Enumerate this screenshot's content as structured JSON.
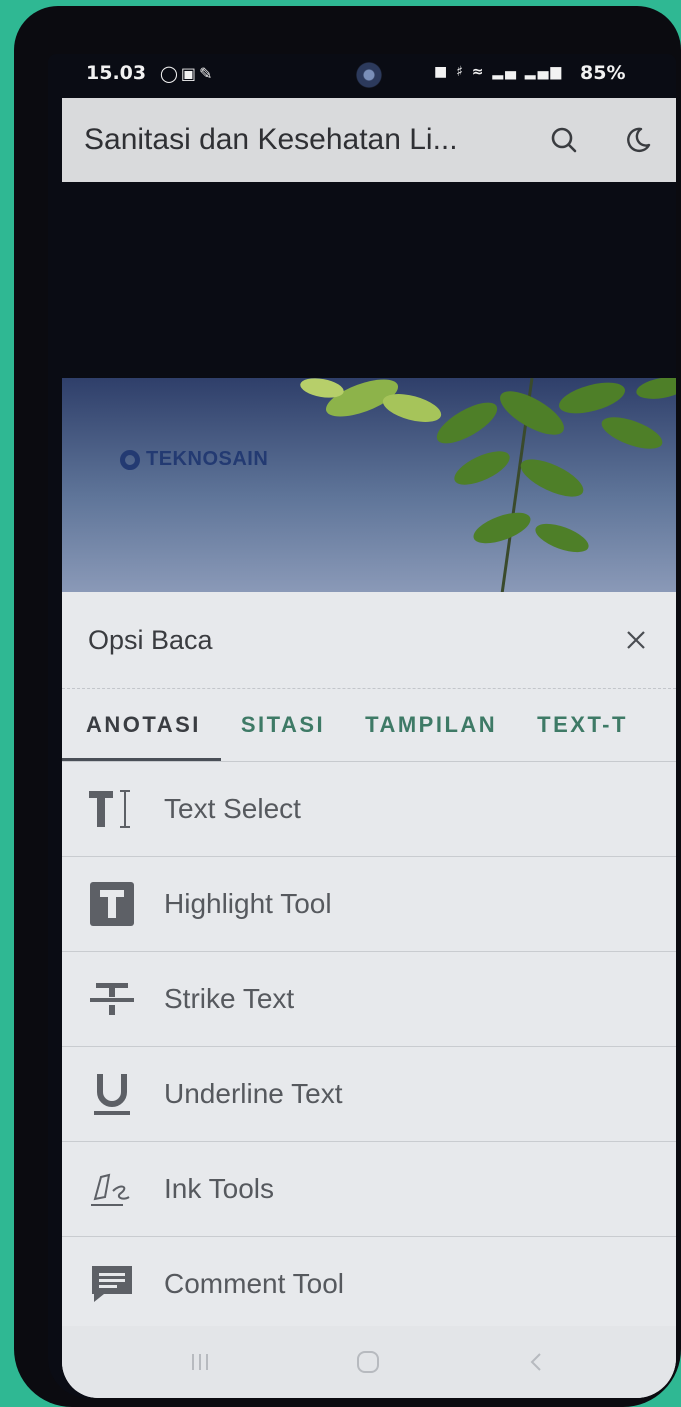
{
  "status_bar": {
    "time": "15.03",
    "left_icons": [
      "whatsapp-icon",
      "instagram-icon",
      "lock-icon"
    ],
    "right_icons": [
      "sim-icon",
      "mute-icon",
      "wifi-icon",
      "signal-icon",
      "lte-signal-icon"
    ],
    "battery": "85%"
  },
  "app_bar": {
    "title": "Sanitasi dan Kesehatan Li...",
    "actions": [
      "search-icon",
      "dark-mode-icon"
    ]
  },
  "cover": {
    "brand": "TEKNOSAIN"
  },
  "sheet": {
    "title": "Opsi Baca",
    "tabs": [
      {
        "label": "ANOTASI",
        "active": true
      },
      {
        "label": "SITASI",
        "active": false
      },
      {
        "label": "TAMPILAN",
        "active": false
      },
      {
        "label": "TEXT-T",
        "active": false
      }
    ],
    "tools": [
      {
        "label": "Text Select",
        "icon": "text-select-icon"
      },
      {
        "label": "Highlight Tool",
        "icon": "highlight-icon"
      },
      {
        "label": "Strike Text",
        "icon": "strikethrough-icon"
      },
      {
        "label": "Underline Text",
        "icon": "underline-icon"
      },
      {
        "label": "Ink Tools",
        "icon": "ink-pen-icon"
      },
      {
        "label": "Comment Tool",
        "icon": "comment-icon"
      }
    ]
  },
  "nav_bar": {
    "buttons": [
      "recents-button",
      "home-button",
      "back-button"
    ]
  },
  "colors": {
    "accent_tab": "#3e7a66",
    "sheet_bg": "#e7e9ec",
    "app_bar_bg": "#d9dadc",
    "outer_bg": "#2fb893"
  }
}
